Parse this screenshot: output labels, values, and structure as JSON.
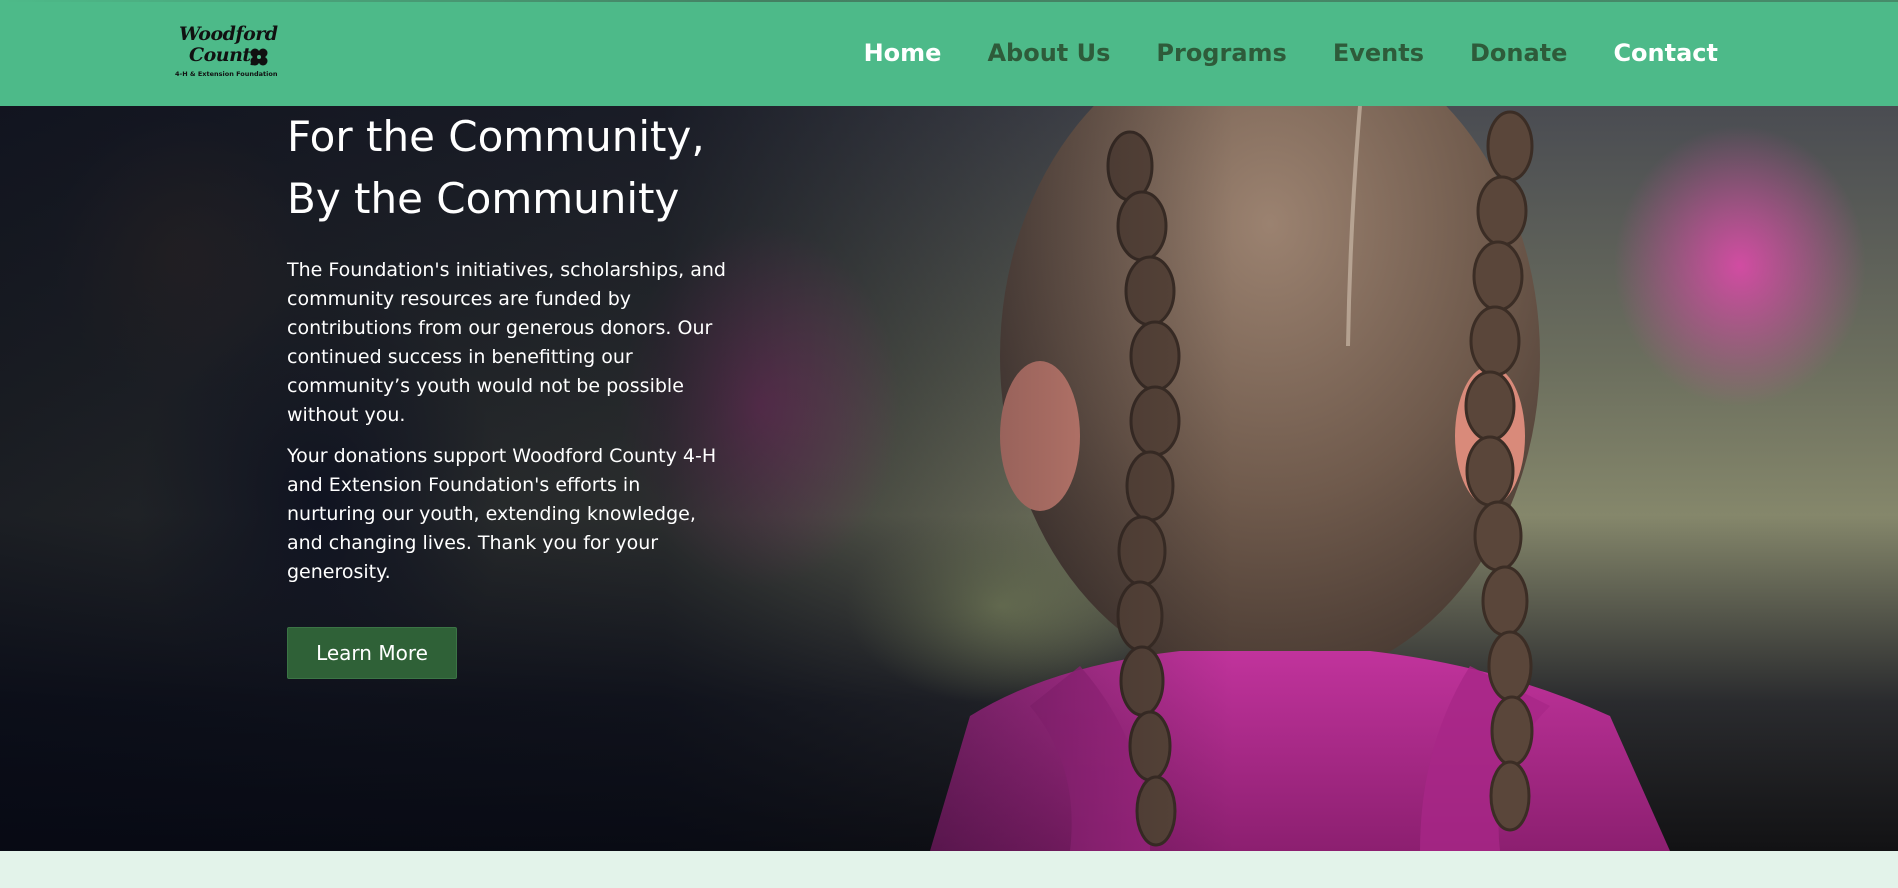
{
  "logo": {
    "line1": "Woodford",
    "line2": "County",
    "tagline": "4-H & Extension Foundation",
    "icon": "four-leaf-clover-icon"
  },
  "nav": {
    "items": [
      {
        "label": "Home"
      },
      {
        "label": "About Us"
      },
      {
        "label": "Programs"
      },
      {
        "label": "Events"
      },
      {
        "label": "Donate"
      },
      {
        "label": "Contact"
      }
    ]
  },
  "hero": {
    "heading_line1": "For the Community,",
    "heading_line2": "By the Community",
    "paragraph1": "The Foundation's initiatives, scholarships, and community resources are funded by contributions from our generous donors. Our continued success in benefitting our community’s youth would not be possible without you.",
    "paragraph2": "Your donations support Woodford County 4-H and Extension Foundation's efforts in nurturing our youth, extending knowledge, and changing lives. Thank you for your generosity.",
    "cta_label": "Learn More"
  },
  "colors": {
    "header_bg": "#4dba89",
    "nav_text": "#2e5b3a",
    "nav_text_light": "#ffffff",
    "button_bg": "#2f6137",
    "page_bg": "#e3f3ea"
  }
}
